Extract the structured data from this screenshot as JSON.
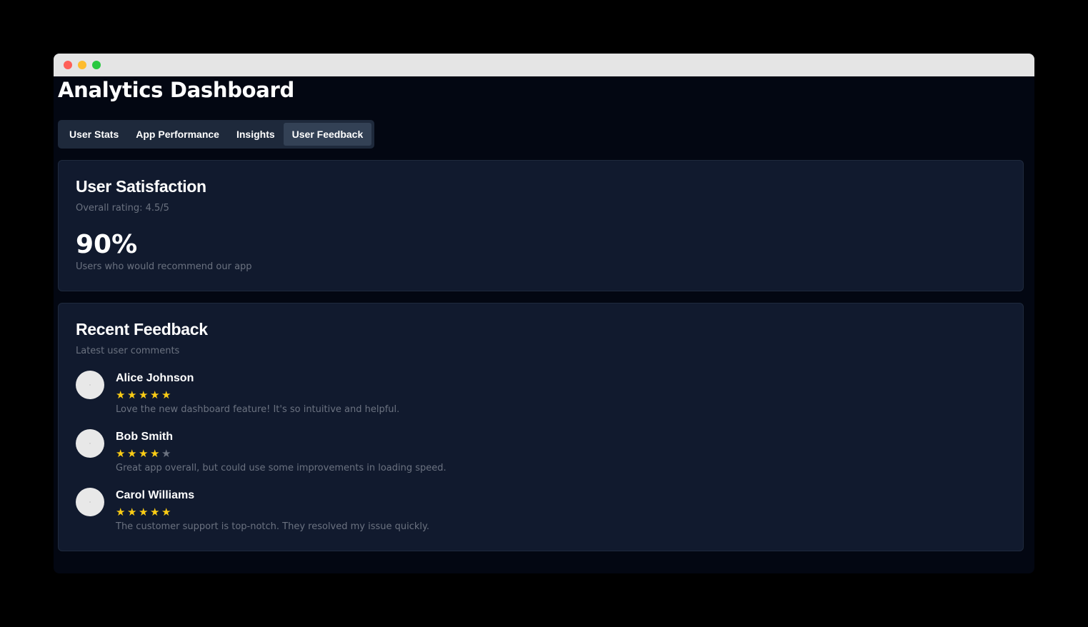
{
  "window": {
    "controls": [
      {
        "name": "close",
        "color": "#ff5f57"
      },
      {
        "name": "minimize",
        "color": "#febc2e"
      },
      {
        "name": "maximize",
        "color": "#28c840"
      }
    ]
  },
  "header": {
    "title": "Analytics Dashboard"
  },
  "tabs": [
    {
      "label": "User Stats",
      "active": false
    },
    {
      "label": "App Performance",
      "active": false
    },
    {
      "label": "Insights",
      "active": false
    },
    {
      "label": "User Feedback",
      "active": true
    }
  ],
  "satisfaction": {
    "title": "User Satisfaction",
    "subtitle": "Overall rating: 4.5/5",
    "stat_value": "90%",
    "stat_description": "Users who would recommend our app"
  },
  "feedback": {
    "title": "Recent Feedback",
    "subtitle": "Latest user comments",
    "star_icon": "star-icon",
    "star_color_filled": "#facc15",
    "star_color_empty": "#6b7280",
    "items": [
      {
        "name": "Alice Johnson",
        "rating": 5,
        "max_rating": 5,
        "comment": "Love the new dashboard feature! It's so intuitive and helpful."
      },
      {
        "name": "Bob Smith",
        "rating": 4,
        "max_rating": 5,
        "comment": "Great app overall, but could use some improvements in loading speed."
      },
      {
        "name": "Carol Williams",
        "rating": 5,
        "max_rating": 5,
        "comment": "The customer support is top-notch. They resolved my issue quickly."
      }
    ]
  }
}
